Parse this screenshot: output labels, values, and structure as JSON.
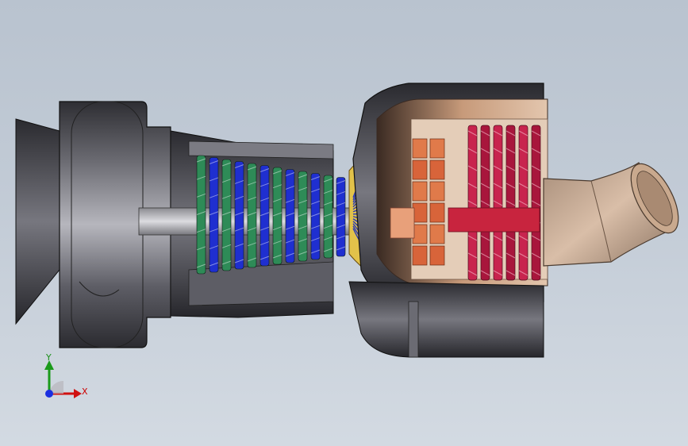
{
  "view": {
    "background_top": "#b9c3cf",
    "background_bottom": "#d3dae2"
  },
  "model": {
    "subject": "turbojet-engine-cutaway",
    "colors": {
      "compressor_green": "#2e8b57",
      "compressor_blue": "#1f2fd0",
      "turbine_orange": "#e07a4a",
      "turbine_red": "#c8244e",
      "shaft": "#c8243e",
      "casing_dark": "#3f3f45",
      "casing_light": "#9a9aa3",
      "nozzle_bronze": "#c4a58c"
    }
  },
  "triad": {
    "x_label": "X",
    "y_label": "Y",
    "x_color": "#d01010",
    "y_color": "#1a9a1a",
    "z_color": "#1b2fe0"
  }
}
